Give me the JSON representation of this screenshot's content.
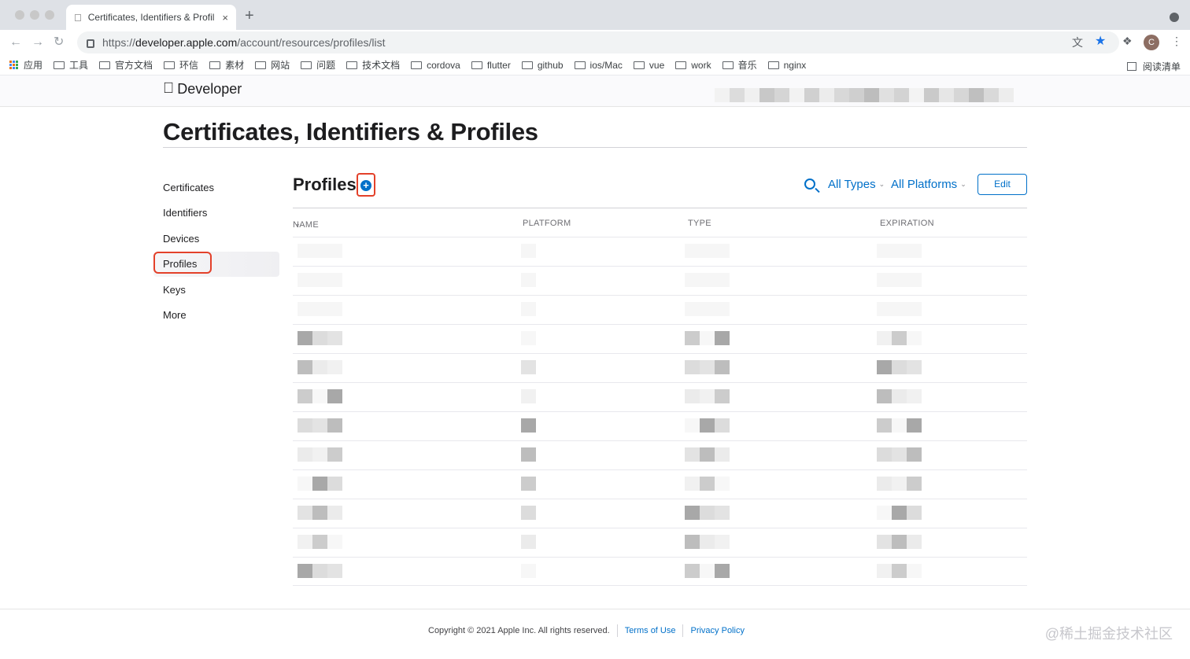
{
  "browser": {
    "tab_title": "Certificates, Identifiers & Profil",
    "tab_close": "×",
    "new_tab": "+",
    "url_prefix": "https://",
    "url_host": "developer.apple.com",
    "url_path": "/account/resources/profiles/list",
    "avatar_initial": "C",
    "bookmarks": [
      "应用",
      "工具",
      "官方文档",
      "环信",
      "素材",
      "网站",
      "问题",
      "技术文档",
      "cordova",
      "flutter",
      "github",
      "ios/Mac",
      "vue",
      "work",
      "音乐",
      "nginx"
    ],
    "reading_list": "阅读清单"
  },
  "site": {
    "brand_name": "Developer",
    "page_title": "Certificates, Identifiers & Profiles"
  },
  "sidebar": {
    "items": [
      {
        "label": "Certificates"
      },
      {
        "label": "Identifiers"
      },
      {
        "label": "Devices"
      },
      {
        "label": "Profiles"
      },
      {
        "label": "Keys"
      },
      {
        "label": "More"
      }
    ],
    "active": "Profiles"
  },
  "main": {
    "heading": "Profiles",
    "add_symbol": "+",
    "filter_types": "All Types",
    "filter_platforms": "All Platforms",
    "edit_label": "Edit",
    "columns": [
      "NAME",
      "PLATFORM",
      "TYPE",
      "EXPIRATION"
    ],
    "row_count": 12
  },
  "footer": {
    "copyright": "Copyright © 2021 Apple Inc. All rights reserved.",
    "terms": "Terms of Use",
    "privacy": "Privacy Policy"
  },
  "watermark": "@稀土掘金技术社区",
  "colors": {
    "link_blue": "#0070c9",
    "highlight_red": "#e3412a"
  }
}
